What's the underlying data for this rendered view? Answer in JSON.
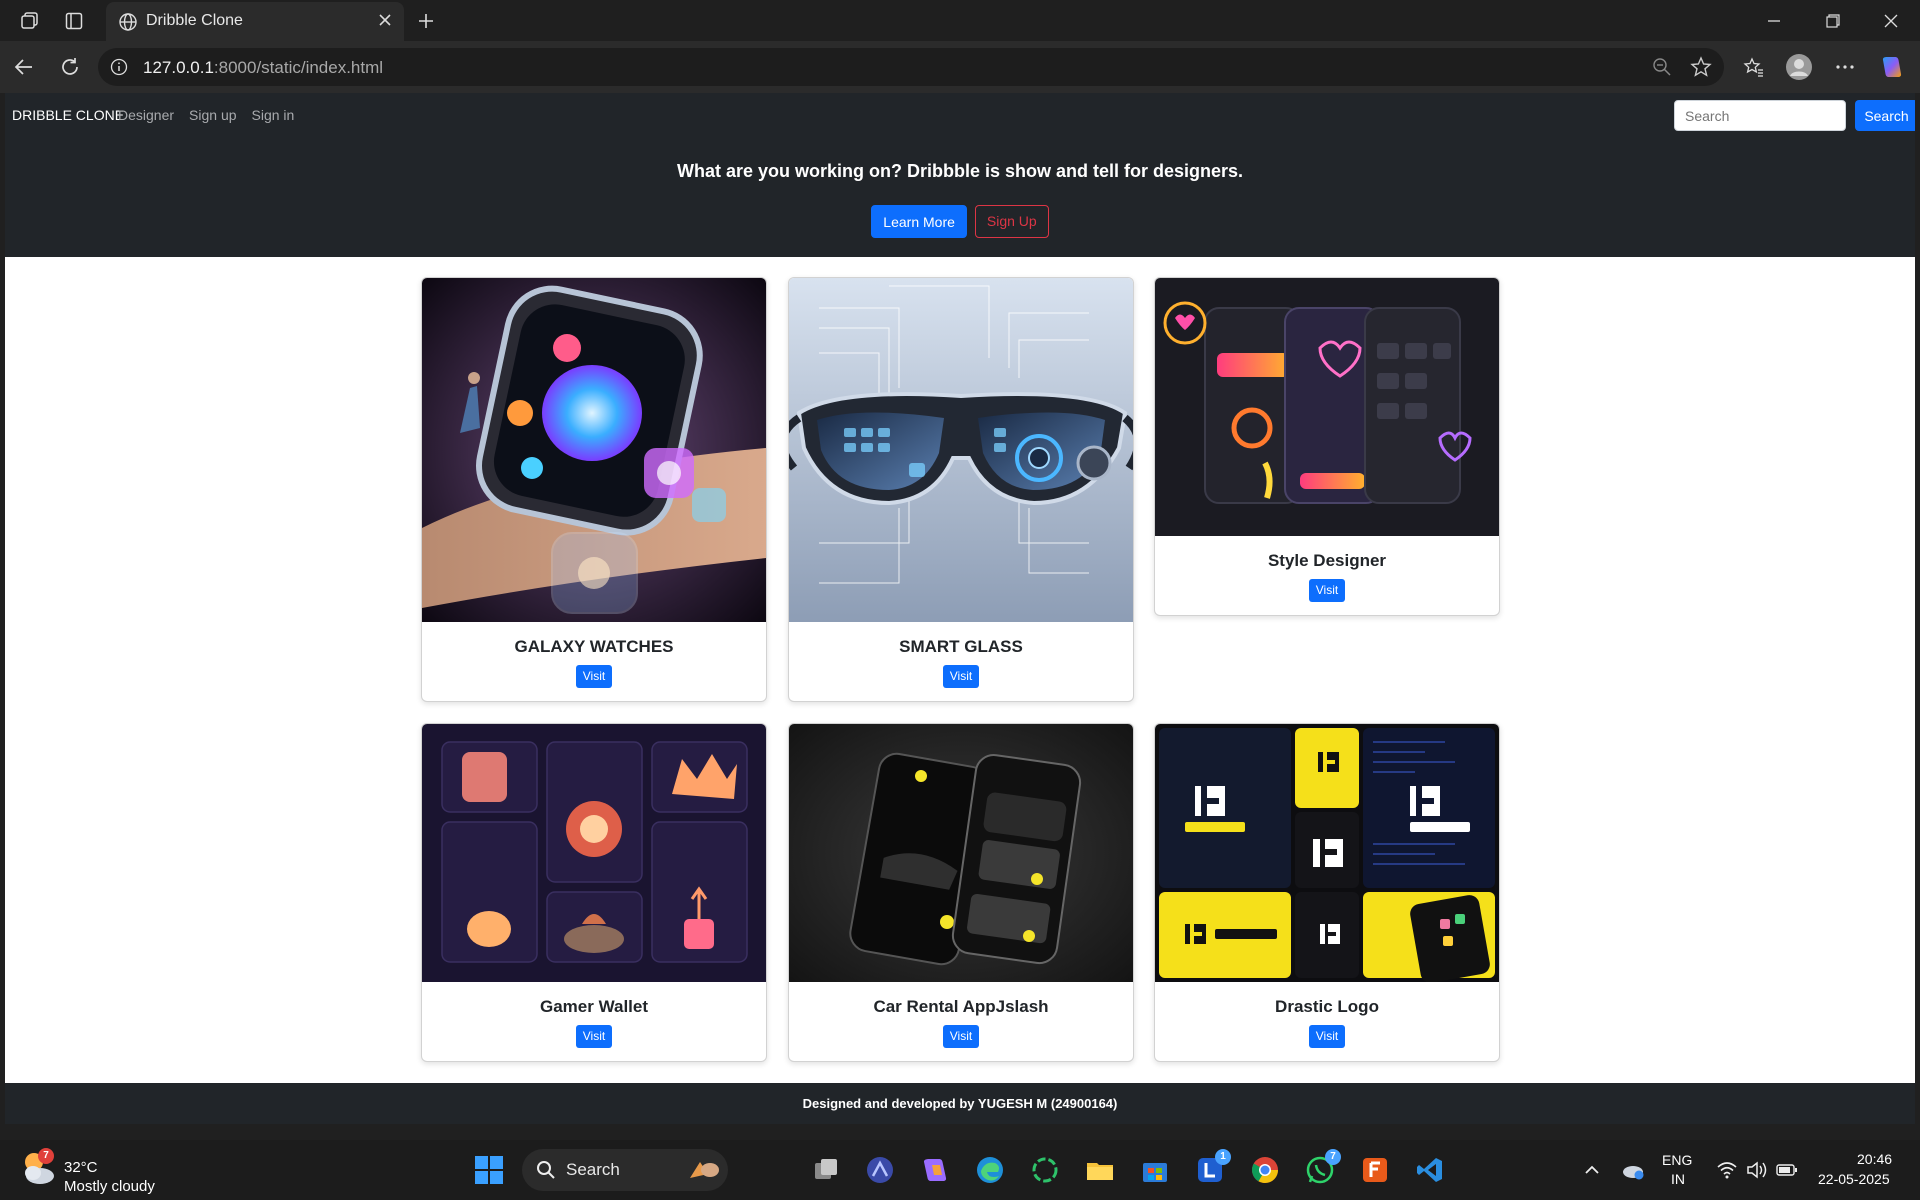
{
  "browser": {
    "tab_title": "Dribble Clone",
    "url_host": "127.0.0.1",
    "url_rest": ":8000/static/index.html"
  },
  "site": {
    "brand": "DRIBBLE CLONE",
    "nav": [
      "Designer",
      "Sign up",
      "Sign in"
    ],
    "search_placeholder": "Search",
    "search_button": "Search",
    "hero_heading": "What are you working on? Dribbble is show and tell for designers.",
    "learn_more": "Learn More",
    "sign_up": "Sign Up",
    "cards": [
      {
        "title": "GALAXY WATCHES",
        "button": "Visit"
      },
      {
        "title": "SMART GLASS",
        "button": "Visit"
      },
      {
        "title": "Style Designer",
        "button": "Visit"
      },
      {
        "title": "Gamer Wallet",
        "button": "Visit"
      },
      {
        "title": "Car Rental AppJslash",
        "button": "Visit"
      },
      {
        "title": "Drastic Logo",
        "button": "Visit"
      }
    ],
    "footer": "Designed and developed by YUGESH M (24900164)"
  },
  "taskbar": {
    "weather_temp": "32°C",
    "weather_desc": "Mostly cloudy",
    "weather_badge": "7",
    "search_label": "Search",
    "lang_top": "ENG",
    "lang_bottom": "IN",
    "time": "20:46",
    "date": "22-05-2025",
    "whatsapp_badge": "7",
    "l_badge": "1"
  },
  "colors": {
    "primary": "#0d6efd",
    "danger": "#dc3545",
    "navbar": "#212529"
  }
}
